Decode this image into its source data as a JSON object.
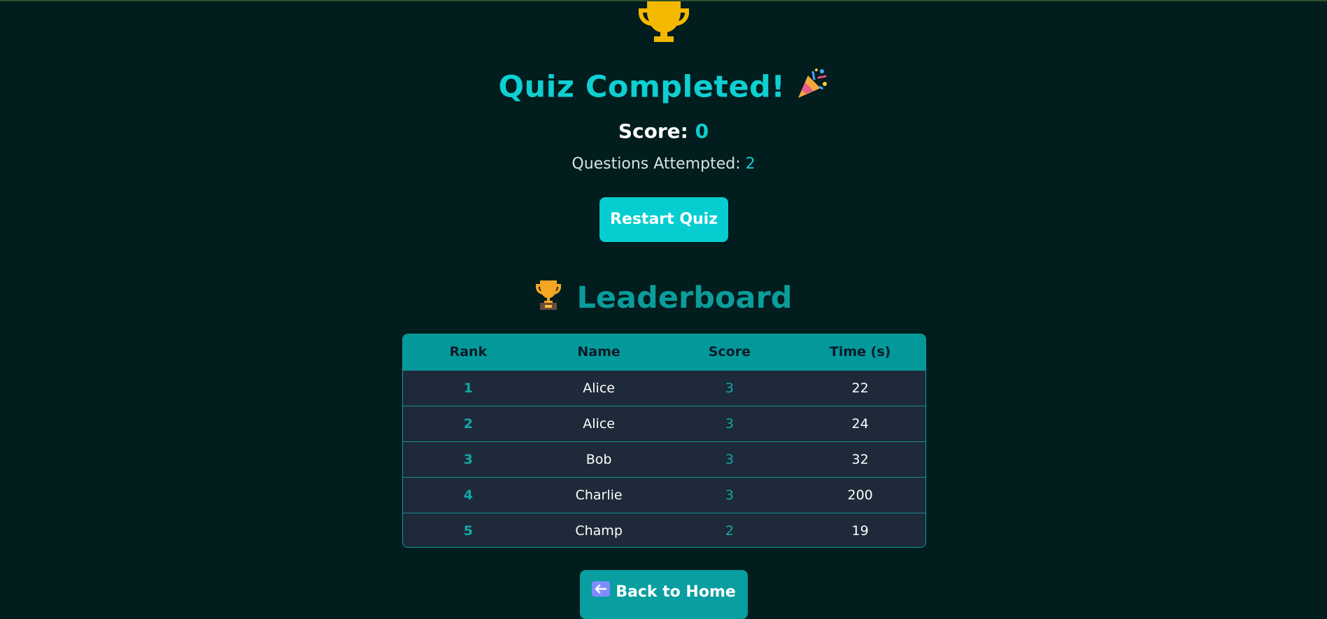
{
  "result": {
    "title": "Quiz Completed!",
    "score_label": "Score: ",
    "score_value": "0",
    "attempted_label": "Questions Attempted: ",
    "attempted_value": "2",
    "restart_label": "Restart Quiz"
  },
  "leaderboard": {
    "heading": "Leaderboard",
    "columns": [
      "Rank",
      "Name",
      "Score",
      "Time (s)"
    ],
    "rows": [
      {
        "rank": "1",
        "name": "Alice",
        "score": "3",
        "time": "22"
      },
      {
        "rank": "2",
        "name": "Alice",
        "score": "3",
        "time": "24"
      },
      {
        "rank": "3",
        "name": "Bob",
        "score": "3",
        "time": "32"
      },
      {
        "rank": "4",
        "name": "Charlie",
        "score": "3",
        "time": "200"
      },
      {
        "rank": "5",
        "name": "Champ",
        "score": "2",
        "time": "19"
      }
    ]
  },
  "footer": {
    "home_label": "Back to Home"
  },
  "icons": {
    "top": "trophy-icon",
    "title": "party-popper-icon",
    "leaderboard": "trophy-icon",
    "home": "back-arrow-icon"
  },
  "colors": {
    "background": "#011d1e",
    "accent": "#0ecfd1",
    "table_header": "#03999a",
    "table_body": "#1e2a39",
    "trophy": "#f5b800"
  }
}
